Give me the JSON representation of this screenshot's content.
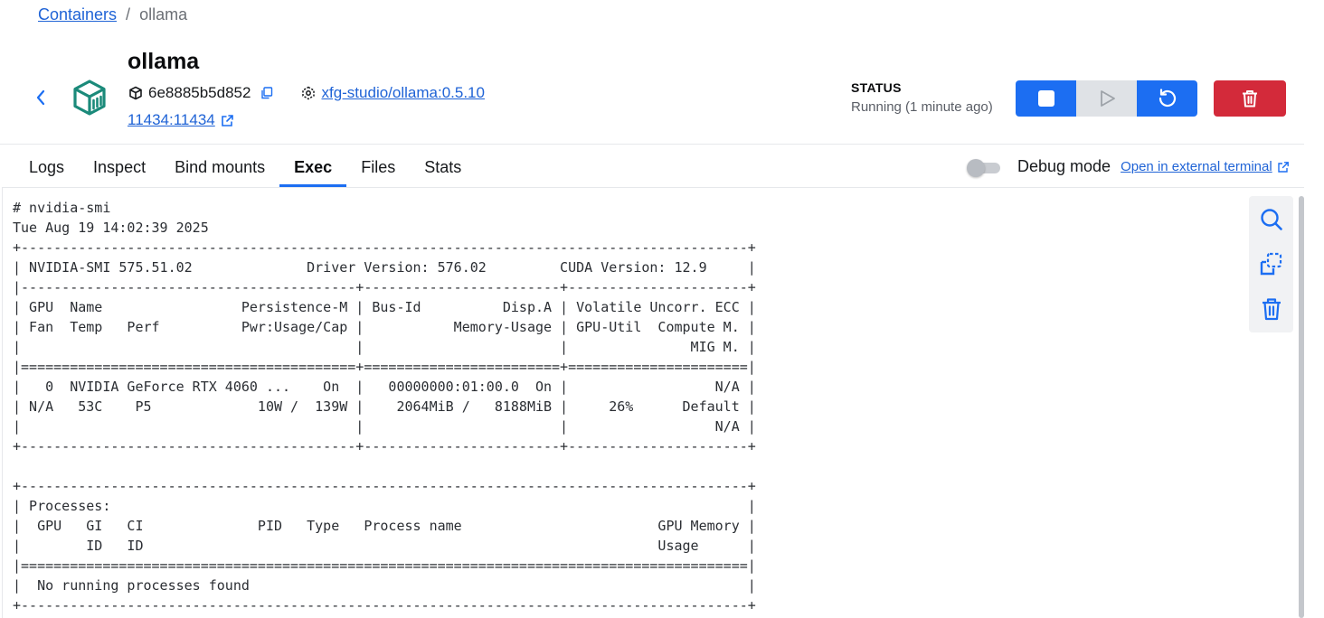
{
  "breadcrumb": {
    "parent": "Containers",
    "separator": "/",
    "current": "ollama"
  },
  "container": {
    "name": "ollama",
    "id": "6e8885b5d852",
    "image": "xfg-studio/ollama:0.5.10",
    "port": "11434:11434"
  },
  "status": {
    "label": "STATUS",
    "value": "Running (1 minute ago)"
  },
  "tabs": [
    {
      "label": "Logs"
    },
    {
      "label": "Inspect"
    },
    {
      "label": "Bind mounts"
    },
    {
      "label": "Exec"
    },
    {
      "label": "Files"
    },
    {
      "label": "Stats"
    }
  ],
  "active_tab": "Exec",
  "debug": {
    "label": "Debug mode",
    "enabled": false,
    "external_link": "Open in external terminal"
  },
  "terminal": {
    "lines": [
      "# nvidia-smi",
      "Tue Aug 19 14:02:39 2025",
      "+-----------------------------------------------------------------------------------------+",
      "| NVIDIA-SMI 575.51.02              Driver Version: 576.02         CUDA Version: 12.9     |",
      "|-----------------------------------------+------------------------+----------------------+",
      "| GPU  Name                 Persistence-M | Bus-Id          Disp.A | Volatile Uncorr. ECC |",
      "| Fan  Temp   Perf          Pwr:Usage/Cap |           Memory-Usage | GPU-Util  Compute M. |",
      "|                                         |                        |               MIG M. |",
      "|=========================================+========================+======================|",
      "|   0  NVIDIA GeForce RTX 4060 ...    On  |   00000000:01:00.0  On |                  N/A |",
      "| N/A   53C    P5             10W /  139W |    2064MiB /   8188MiB |     26%      Default |",
      "|                                         |                        |                  N/A |",
      "+-----------------------------------------+------------------------+----------------------+",
      "",
      "+-----------------------------------------------------------------------------------------+",
      "| Processes:                                                                              |",
      "|  GPU   GI   CI              PID   Type   Process name                        GPU Memory |",
      "|        ID   ID                                                               Usage      |",
      "|=========================================================================================|",
      "|  No running processes found                                                             |",
      "+-----------------------------------------------------------------------------------------+"
    ]
  },
  "colors": {
    "primary": "#1c6ef2",
    "danger": "#d32a3a",
    "link": "#1f63d6",
    "container_icon": "#1b8a7a"
  },
  "icons": {
    "back": "chevron-left-icon",
    "container": "container-box-icon",
    "stop": "stop-icon",
    "play": "play-icon",
    "restart": "restart-icon",
    "delete": "trash-icon",
    "search": "search-icon",
    "copy": "copy-icon",
    "clear": "trash-icon"
  }
}
